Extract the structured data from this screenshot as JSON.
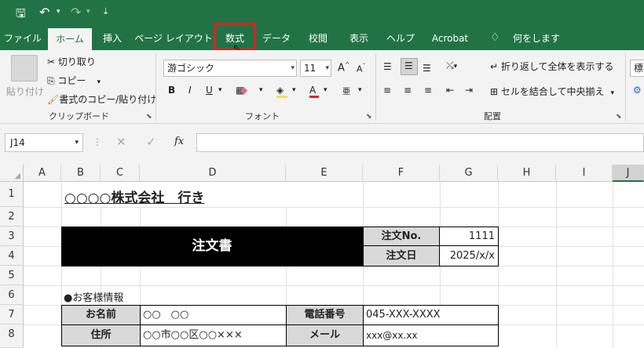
{
  "tabs": [
    "ファイル",
    "ホーム",
    "挿入",
    "ページ レイアウト",
    "数式",
    "データ",
    "校閲",
    "表示",
    "ヘルプ",
    "Acrobat",
    "何をしますか"
  ],
  "ribbon": {
    "clipboard": {
      "paste": "貼り付け",
      "cut": "切り取り",
      "copy": "コピー",
      "format_painter": "書式のコピー/貼り付け",
      "label": "クリップボード"
    },
    "font": {
      "name": "游ゴシック",
      "size": "11",
      "label": "フォント"
    },
    "alignment": {
      "wrap": "折り返して全体を表示する",
      "merge": "セルを結合して中央揃え",
      "label": "配置"
    },
    "number": {
      "format_partial": "標"
    }
  },
  "formula": {
    "name_box": "J14",
    "fx": "fx"
  },
  "columns": [
    "A",
    "B",
    "C",
    "D",
    "E",
    "F",
    "G",
    "H",
    "I",
    "J"
  ],
  "rows": [
    "1",
    "2",
    "3",
    "4",
    "5",
    "6",
    "7",
    "8"
  ],
  "sheet": {
    "title": "○○○○株式会社　行き",
    "order_title": "注文書",
    "order_no_label": "注文No.",
    "order_no": "1111",
    "order_date_label": "注文日",
    "order_date": "2025/x/x",
    "customer_section": "●お客様情報",
    "name_label": "お名前",
    "name_value": "○○　○○",
    "phone_label": "電話番号",
    "phone_value": "045-XXX-XXXX",
    "address_label": "住所",
    "address_value": "○○市○○区○○×××",
    "email_label": "メール",
    "email_value": "xxx@xx.xx"
  },
  "colors": {
    "accent": "#217346",
    "highlight": "#e02020"
  }
}
